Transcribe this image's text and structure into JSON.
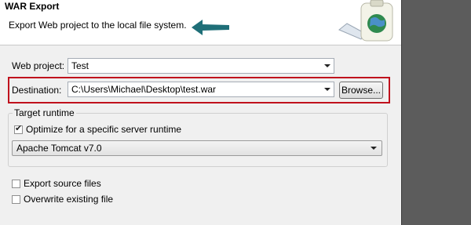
{
  "banner": {
    "title": "WAR Export",
    "description": "Export Web project to the local file system."
  },
  "web_project": {
    "label": "Web project:",
    "value": "Test"
  },
  "destination": {
    "label": "Destination:",
    "value": "C:\\Users\\Michael\\Desktop\\test.war",
    "browse_label": "Browse..."
  },
  "target_runtime": {
    "title": "Target runtime",
    "optimize_label": "Optimize for a specific server runtime",
    "optimize_checked": true,
    "runtime_value": "Apache Tomcat v7.0"
  },
  "options": {
    "export_source_label": "Export source files",
    "export_source_checked": false,
    "overwrite_label": "Overwrite existing file",
    "overwrite_checked": false
  },
  "colors": {
    "highlight": "#c0111d",
    "arrow": "#1f6f78"
  },
  "icons": {
    "arrow": "arrow-left-icon",
    "wizard": "war-export-wizard-icon"
  }
}
